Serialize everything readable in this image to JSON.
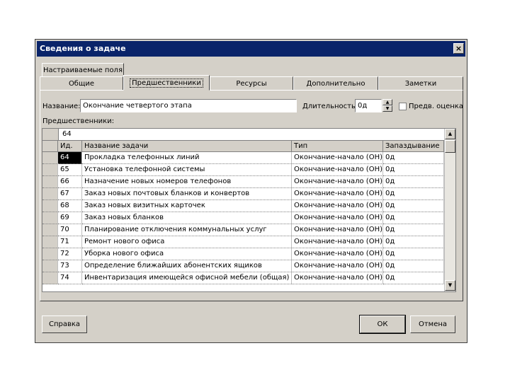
{
  "window": {
    "title": "Сведения о задаче",
    "close_label": "×"
  },
  "tabs_back": [
    {
      "label": "Настраиваемые поля"
    }
  ],
  "tabs_front": [
    {
      "label": "Общие"
    },
    {
      "label": "Предшественники"
    },
    {
      "label": "Ресурсы"
    },
    {
      "label": "Дополнительно"
    },
    {
      "label": "Заметки"
    }
  ],
  "form": {
    "name_label": "Название:",
    "name_value": "Окончание четвертого этапа",
    "duration_label": "Длительность:",
    "duration_value": "0д",
    "estimate_label": "Предв. оценка",
    "predecessors_label": "Предшественники:"
  },
  "grid": {
    "edit_value": "64",
    "headers": [
      "Ид.",
      "Название задачи",
      "Тип",
      "Запаздывание"
    ],
    "rows": [
      {
        "id": "64",
        "name": "Прокладка телефонных линий",
        "type": "Окончание-начало (ОН)",
        "lag": "0д"
      },
      {
        "id": "65",
        "name": "Установка телефонной системы",
        "type": "Окончание-начало (ОН)",
        "lag": "0д"
      },
      {
        "id": "66",
        "name": "Назначение новых номеров телефонов",
        "type": "Окончание-начало (ОН)",
        "lag": "0д"
      },
      {
        "id": "67",
        "name": "Заказ новых почтовых бланков и конвертов",
        "type": "Окончание-начало (ОН)",
        "lag": "0д"
      },
      {
        "id": "68",
        "name": "Заказ новых визитных карточек",
        "type": "Окончание-начало (ОН)",
        "lag": "0д"
      },
      {
        "id": "69",
        "name": "Заказ новых бланков",
        "type": "Окончание-начало (ОН)",
        "lag": "0д"
      },
      {
        "id": "70",
        "name": "Планирование отключения коммунальных услуг",
        "type": "Окончание-начало (ОН)",
        "lag": "0д"
      },
      {
        "id": "71",
        "name": "Ремонт нового офиса",
        "type": "Окончание-начало (ОН)",
        "lag": "0д"
      },
      {
        "id": "72",
        "name": "Уборка нового офиса",
        "type": "Окончание-начало (ОН)",
        "lag": "0д"
      },
      {
        "id": "73",
        "name": "Определение ближайших абонентских ящиков",
        "type": "Окончание-начало (ОН)",
        "lag": "0д"
      },
      {
        "id": "74",
        "name": "Инвентаризация имеющейся офисной мебели (общая)",
        "type": "Окончание-начало (ОН)",
        "lag": "0д"
      }
    ]
  },
  "buttons": {
    "help": "Справка",
    "ok": "ОК",
    "cancel": "Отмена"
  }
}
